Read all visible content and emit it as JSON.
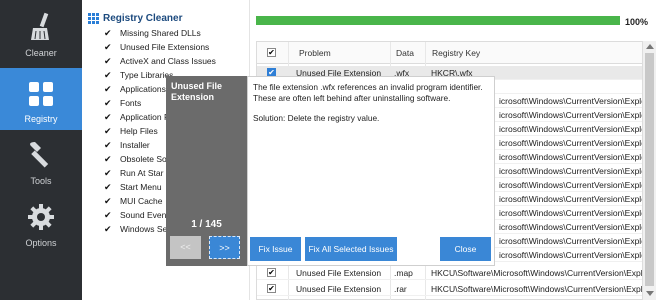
{
  "nav": {
    "items": [
      {
        "label": "Cleaner",
        "icon": "broom-icon"
      },
      {
        "label": "Registry",
        "icon": "registry-grid-icon"
      },
      {
        "label": "Tools",
        "icon": "wrench-icon"
      },
      {
        "label": "Options",
        "icon": "gear-icon"
      }
    ],
    "active": "Registry"
  },
  "checklist": {
    "title": "Registry Cleaner",
    "items": [
      "Missing Shared DLLs",
      "Unused File Extensions",
      "ActiveX and Class Issues",
      "Type Libraries",
      "Applications",
      "Fonts",
      "Application P",
      "Help Files",
      "Installer",
      "Obsolete So",
      "Run At Star",
      "Start Menu",
      "MUI Cache",
      "Sound Even",
      "Windows Se"
    ]
  },
  "progress": {
    "percent_label": "100%",
    "value": 1.0
  },
  "table": {
    "columns": [
      "Problem",
      "Data",
      "Registry Key"
    ],
    "rows": [
      {
        "problem": "Unused File Extension",
        "data": ".wfx",
        "key": "HKCR\\.wfx"
      },
      {
        "problem": "",
        "data": "",
        "key": ""
      },
      {
        "problem": "",
        "data": "",
        "key": "icrosoft\\Windows\\CurrentVersion\\Explo"
      },
      {
        "problem": "",
        "data": "",
        "key": "icrosoft\\Windows\\CurrentVersion\\Explo"
      },
      {
        "problem": "",
        "data": "",
        "key": "icrosoft\\Windows\\CurrentVersion\\Explo"
      },
      {
        "problem": "",
        "data": "",
        "key": "icrosoft\\Windows\\CurrentVersion\\Explo"
      },
      {
        "problem": "",
        "data": "",
        "key": "icrosoft\\Windows\\CurrentVersion\\Explo"
      },
      {
        "problem": "",
        "data": "",
        "key": "icrosoft\\Windows\\CurrentVersion\\Explo"
      },
      {
        "problem": "",
        "data": "",
        "key": "icrosoft\\Windows\\CurrentVersion\\Explo"
      },
      {
        "problem": "",
        "data": "",
        "key": "icrosoft\\Windows\\CurrentVersion\\Explo"
      },
      {
        "problem": "",
        "data": "",
        "key": "icrosoft\\Windows\\CurrentVersion\\Explo"
      },
      {
        "problem": "",
        "data": "",
        "key": "icrosoft\\Windows\\CurrentVersion\\Explo"
      },
      {
        "problem": "",
        "data": "",
        "key": "icrosoft\\Windows\\CurrentVersion\\Explo"
      },
      {
        "problem": "",
        "data": "",
        "key": "icrosoft\\Windows\\CurrentVersion\\Explo"
      },
      {
        "problem": "Unused File Extension",
        "data": ".map",
        "key": "HKCU\\Software\\Microsoft\\Windows\\CurrentVersion\\Explo"
      },
      {
        "problem": "Unused File Extension",
        "data": ".rar",
        "key": "HKCU\\Software\\Microsoft\\Windows\\CurrentVersion\\Explo"
      }
    ]
  },
  "dialog": {
    "title": "Unused File Extension",
    "description": "The file extension .wfx references an invalid program identifier. These are often left behind after uninstalling software.",
    "solution": "Solution: Delete the registry value.",
    "pager": "1 / 145",
    "prev_label": "<<",
    "next_label": ">>",
    "fix_label": "Fix Issue",
    "fix_all_label": "Fix All Selected Issues",
    "close_label": "Close"
  },
  "colors": {
    "nav_bg": "#2c2f33",
    "accent": "#3a89d8",
    "progress": "#49b54a",
    "dialog_side": "#6b6b6b"
  }
}
